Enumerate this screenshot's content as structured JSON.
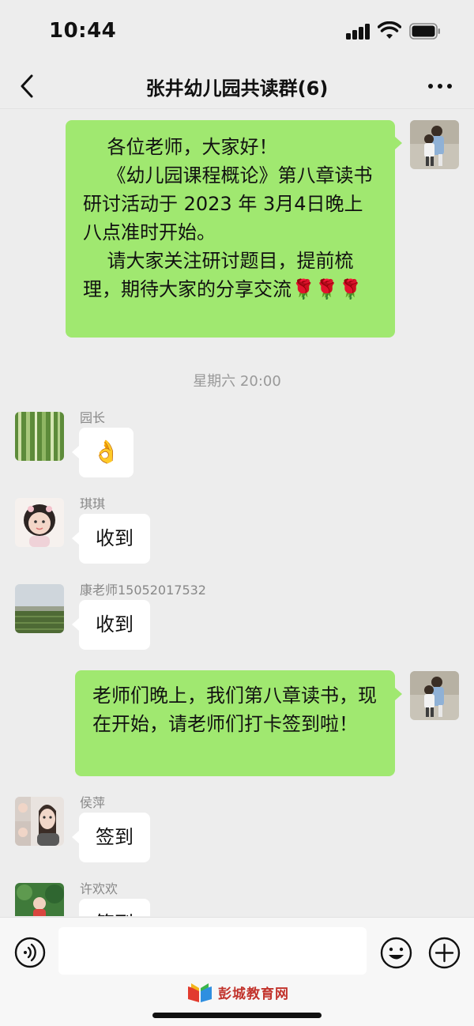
{
  "status_bar": {
    "time": "10:44"
  },
  "header": {
    "title": "张井幼儿园共读群(6)"
  },
  "messages": [
    {
      "side": "right",
      "paragraphs": [
        "    各位老师，大家好！",
        "    《幼儿园课程概论》第八章读书研讨活动于 2023 年 3月4日晚上八点准时开始。",
        "    请大家关注研讨题目，提前梳理，期待大家的分享交流🌹🌹🌹"
      ]
    },
    {
      "side": "left",
      "sender": "园长",
      "text": "👌"
    },
    {
      "side": "left",
      "sender": "琪琪",
      "text": "收到"
    },
    {
      "side": "left",
      "sender": "康老师15052017532",
      "text": "收到"
    },
    {
      "side": "right",
      "paragraphs": [
        "老师们晚上，我们第八章读书，现在开始，请老师们打卡签到啦！"
      ]
    },
    {
      "side": "left",
      "sender": "侯萍",
      "text": "签到"
    },
    {
      "side": "left",
      "sender": "许欢欢",
      "text": "签到"
    }
  ],
  "timestamp": "星期六 20:00",
  "watermark": {
    "text": "彭城教育网"
  },
  "colors": {
    "my_bubble": "#a0e870",
    "their_bubble": "#ffffff",
    "background": "#ededed"
  },
  "icons": {
    "back": "chevron-left-icon",
    "more": "more-dots-icon",
    "voice": "voice-icon",
    "emoji": "emoji-icon",
    "plus": "plus-icon"
  }
}
